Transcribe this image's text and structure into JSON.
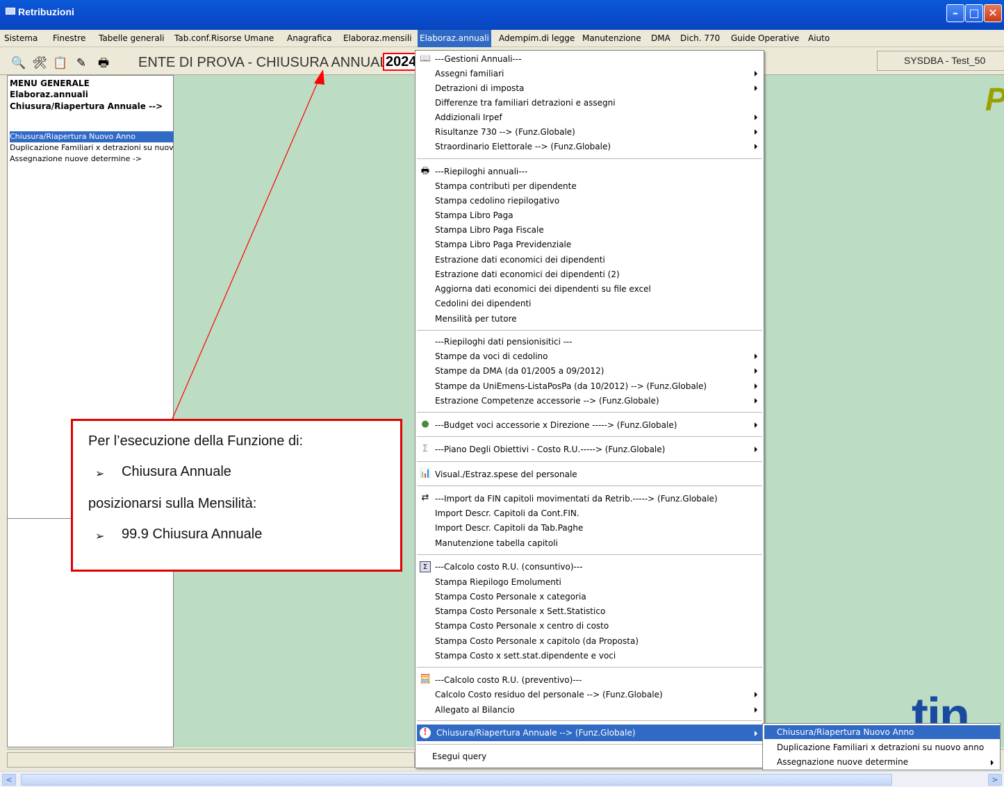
{
  "window": {
    "title": "Retribuzioni"
  },
  "menubar": {
    "items": [
      "Sistema",
      "Finestre",
      "Tabelle generali",
      "Tab.conf.Risorse Umane",
      "Anagrafica",
      "Elaboraz.mensili",
      "Elaboraz.annuali",
      "Adempim.di legge",
      "Manutenzione",
      "DMA",
      "Dich. 770",
      "Guide Operative",
      "Aiuto"
    ]
  },
  "toolbar": {
    "ente": "ENTE DI PROVA - CHIUSURA ANNUALE",
    "year": "2024",
    "user": "SYSDBA - Test_50"
  },
  "left_panel": {
    "h1": "MENU GENERALE",
    "h2": "Elaboraz.annuali",
    "h3": "Chiusura/Riapertura Annuale -->",
    "items": [
      "Chiusura/Riapertura Nuovo Anno",
      "Duplicazione Familiari x detrazioni su nuovo anno",
      "Assegnazione nuove determine ->"
    ]
  },
  "background": {
    "letter_top": "P",
    "letter_bottom": "tin"
  },
  "menu": {
    "items": [
      "---Gestioni Annuali---",
      "Assegni familiari",
      "Detrazioni di imposta",
      "Differenze tra familiari detrazioni e assegni",
      "Addizionali Irpef",
      "Risultanze 730 --> (Funz.Globale)",
      "Straordinario Elettorale --> (Funz.Globale)",
      "---Riepiloghi annuali---",
      "Stampa contributi per dipendente",
      "Stampa cedolino riepilogativo",
      "Stampa Libro Paga",
      "Stampa Libro Paga Fiscale",
      "Stampa Libro Paga Previdenziale",
      "Estrazione dati economici dei dipendenti",
      "Estrazione dati economici dei dipendenti (2)",
      "Aggiorna dati economici dei dipendenti su file excel",
      "Cedolini dei dipendenti",
      "Mensilità per tutore",
      "---Riepiloghi dati pensionisitici ---",
      "Stampe da voci di cedolino",
      "Stampe da DMA (da 01/2005 a 09/2012)",
      "Stampe da UniEmens-ListaPosPa (da 10/2012)  --> (Funz.Globale)",
      "Estrazione Competenze accessorie  --> (Funz.Globale)",
      "---Budget voci accessorie x Direzione -----> (Funz.Globale)",
      "---Piano Degli Obiettivi - Costo R.U.-----> (Funz.Globale)",
      "Visual./Estraz.spese del personale",
      "---Import da FIN capitoli movimentati da Retrib.-----> (Funz.Globale)",
      "Import Descr. Capitoli da Cont.FIN.",
      "Import Descr. Capitoli da Tab.Paghe",
      "Manutenzione tabella capitoli",
      "---Calcolo costo R.U. (consuntivo)---",
      "Stampa Riepilogo Emolumenti",
      "Stampa Costo Personale x categoria",
      "Stampa Costo Personale x Sett.Statistico",
      "Stampa Costo Personale x centro di costo",
      "Stampa Costo Personale x capitolo (da Proposta)",
      "Stampa Costo x sett.stat.dipendente e voci",
      "---Calcolo costo R.U. (preventivo)---",
      "Calcolo Costo residuo del personale --> (Funz.Globale)",
      "Allegato al Bilancio",
      "Chiusura/Riapertura Annuale --> (Funz.Globale)",
      "Esegui query"
    ]
  },
  "submenu": {
    "items": [
      "Chiusura/Riapertura Nuovo Anno",
      "Duplicazione Familiari x detrazioni su nuovo anno",
      "Assegnazione nuove determine"
    ]
  },
  "callout": {
    "l1": "Per l’esecuzione della Funzione di:",
    "l2": "Chiusura Annuale",
    "l3": "posizionarsi sulla Mensilità:",
    "l4": "99.9 Chiusura Annuale",
    "bullet": "➢"
  },
  "colors": {
    "title_blue": "#0a5ad8",
    "highlight": "#316ac5",
    "desktop_green": "#bcdcc4",
    "callout_red": "#e00000"
  }
}
